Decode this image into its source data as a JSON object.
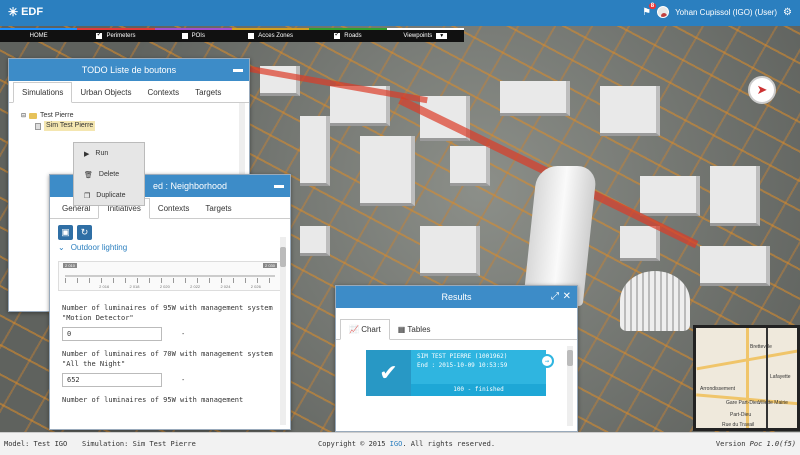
{
  "header": {
    "logo_text": "EDF",
    "notification_count": "8",
    "user_label": "Yohan Cupissol (IGO) (User)"
  },
  "layers": [
    {
      "label": "HOME",
      "checked": false,
      "color": "#1e90ff",
      "has_checkbox": false
    },
    {
      "label": "Perimeters",
      "checked": true,
      "color": "#e03a3a",
      "has_checkbox": true
    },
    {
      "label": "POIs",
      "checked": false,
      "color": "#a050d0",
      "has_checkbox": true
    },
    {
      "label": "Acces Zones",
      "checked": false,
      "color": "#d2a020",
      "has_checkbox": true
    },
    {
      "label": "Roads",
      "checked": true,
      "color": "#30a030",
      "has_checkbox": true
    },
    {
      "label": "Viewpoints",
      "checked": false,
      "color": "#ffffff",
      "has_checkbox": false,
      "dropdown": "▼"
    }
  ],
  "todo_panel": {
    "title": "TODO Liste de boutons",
    "tabs": [
      "Simulations",
      "Urban Objects",
      "Contexts",
      "Targets"
    ],
    "tree": {
      "root": "Test Pierre",
      "child": "Sim Test Pierre"
    }
  },
  "context_menu": {
    "items": [
      "Run",
      "Delete",
      "Duplicate"
    ]
  },
  "neighborhood_panel": {
    "title": "ed : Neighborhood",
    "tabs": [
      "General",
      "Initiatives",
      "Contexts",
      "Targets"
    ],
    "section": "Outdoor lighting",
    "slider": {
      "min_badge": "2 010",
      "max_badge": "2 030",
      "tick_labels": [
        "2 016",
        "2 018",
        "2 020",
        "2 022",
        "2 024",
        "2 026"
      ]
    },
    "fields": [
      {
        "label": "Number of luminaires of 95W with management system \"Motion Detector\"",
        "value": "0"
      },
      {
        "label": "Number of luminaires of 70W with management system \"All the Night\"",
        "value": "652"
      },
      {
        "label": "Number of luminaires of 95W with management",
        "value": ""
      }
    ],
    "dash": "-"
  },
  "results_panel": {
    "title": "Results",
    "tabs": [
      "Chart",
      "Tables"
    ],
    "card": {
      "name": "SIM TEST PIERRE (1001962)",
      "end": "End : 2015-10-09 10:53:59",
      "status": "100 - finished"
    }
  },
  "minimap": {
    "labels": [
      "Bretteville",
      "Lafayette",
      "Gare Part-Dieu",
      "Villette Mairie",
      "Part-Dieu",
      "Rue du Travail",
      "Arrondissement"
    ]
  },
  "footer": {
    "model_label": "Model:",
    "model_value": "Test IGO",
    "simulation_label": "Simulation:",
    "simulation_value": "Sim Test Pierre",
    "copyright_prefix": "Copyright © 2015",
    "copyright_company": "IGO",
    "copyright_suffix": ". All rights reserved.",
    "version_label": "Version",
    "version_value": "Poc 1.0(f5)"
  }
}
